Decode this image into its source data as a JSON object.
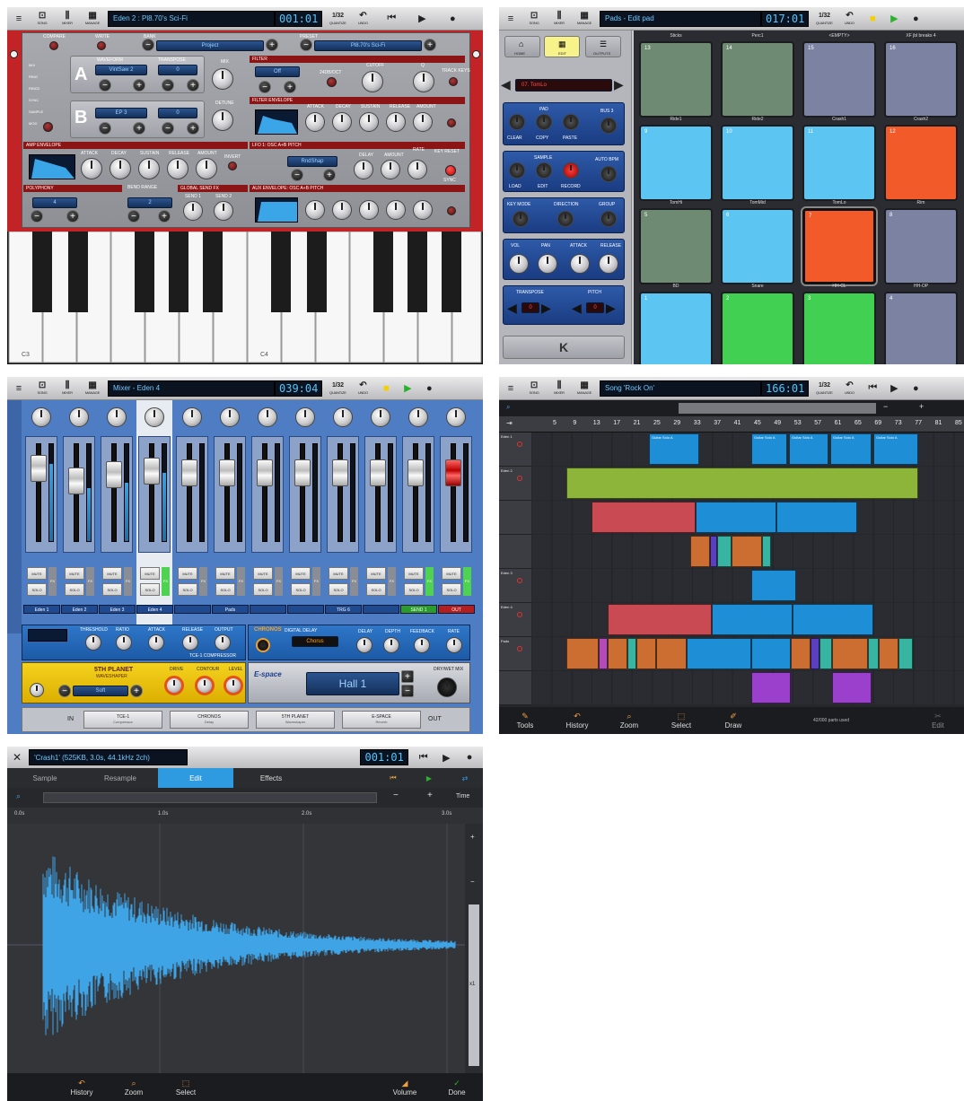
{
  "toolbar": {
    "menu_icon": "≡",
    "song": "SONG",
    "mixer": "MIXER",
    "manage": "MANAGE",
    "quantize_value": "1/32",
    "quantize_label": "QUANTIZE",
    "undo": "UNDO"
  },
  "synth": {
    "title": "Eden 2 : Pl8.70's Sci-Fi",
    "position": "001:01",
    "compare": "COMPARE",
    "write": "WRITE",
    "bank_label": "BANK",
    "bank_value": "Project",
    "preset_label": "PRESET",
    "preset_value": "Pl8.70's Sci-Fi",
    "mix": "MIX",
    "ring": "RING",
    "ring2": "RING2",
    "sync": "SYNC",
    "sample": "SAMPLE",
    "mod": "MOD",
    "osc_a": "A",
    "osc_b": "B",
    "osc_a_label": "OSC",
    "waveform": "WAVEFORM",
    "transpose": "TRANSPOSE",
    "wave_a": "VintSaw 2",
    "trans_a": "0",
    "wave_b": "EP 3",
    "trans_b": "0",
    "mix_knob": "MIX",
    "detune": "DETUNE",
    "filter": "FILTER",
    "filter_type": "Off",
    "filter_slope": "24dB/Oct",
    "cutoff": "CUTOFF",
    "q": "Q",
    "track_keys": "TRACK KEYS",
    "filter_env": "FILTER ENVELOPE",
    "amp_env": "AMP ENVELOPE",
    "attack": "ATTACK",
    "decay": "DECAY",
    "sustain": "SUSTAIN",
    "release": "RELEASE",
    "amount": "AMOUNT",
    "invert": "INVERT",
    "lfo": "LFO 1: Osc A+B Pitch",
    "lfo_shape": "RndShap",
    "delay": "DELAY",
    "rate": "RATE",
    "key_reset": "KEY RESET",
    "sync_lbl": "SYNC",
    "polyphony": "POLYPHONY",
    "poly_val": "4",
    "bend_range": "BEND RANGE",
    "bend_val": "2",
    "global_send": "GLOBAL SEND FX",
    "send1": "SEND 1",
    "send2": "SEND 2",
    "aux_env": "AUX ENVELOPE: Osc A+B Pitch",
    "c3": "C3",
    "c4": "C4"
  },
  "pads": {
    "title": "Pads - Edit pad",
    "position": "017:01",
    "home": "HOME",
    "edit": "EDIT",
    "outputs": "OUTPUTS",
    "instrument": "07. TomLo",
    "pad": "PAD",
    "clear": "CLEAR",
    "copy": "COPY",
    "paste": "PASTE",
    "bus": "BUS 3",
    "sample": "SAMPLE",
    "load": "LOAD",
    "edit_btn": "EDIT",
    "record": "RECORD",
    "auto_bpm": "AUTO BPM",
    "key_mode": "KEY MODE",
    "direction": "DIRECTION",
    "group": "GROUP",
    "vol": "VOL",
    "pan": "PAN",
    "attack": "ATTACK",
    "release": "RELEASE",
    "transpose": "TRANSPOSE",
    "pitch": "PITCH",
    "transpose_val": "0",
    "pitch_val": "0",
    "grid": [
      {
        "name": "Sticks",
        "num": "13",
        "color": "#6e8a72"
      },
      {
        "name": "Perc1",
        "num": "14",
        "color": "#6e8a72"
      },
      {
        "name": "<EMPTY>",
        "num": "15",
        "color": "#7c83a2"
      },
      {
        "name": "XF jbl breaks 4",
        "num": "16",
        "color": "#7c83a2"
      },
      {
        "name": "Ride1",
        "num": "9",
        "color": "#5cc5f2"
      },
      {
        "name": "Ride2",
        "num": "10",
        "color": "#5cc5f2"
      },
      {
        "name": "Crash1",
        "num": "11",
        "color": "#5cc5f2"
      },
      {
        "name": "Crash2",
        "num": "12",
        "color": "#f25a2a"
      },
      {
        "name": "TomHi",
        "num": "5",
        "color": "#6e8a72"
      },
      {
        "name": "TomMid",
        "num": "6",
        "color": "#5cc5f2"
      },
      {
        "name": "TomLo",
        "num": "7",
        "color": "#f25a2a"
      },
      {
        "name": "Rim",
        "num": "8",
        "color": "#7c83a2"
      },
      {
        "name": "BD",
        "num": "1",
        "color": "#5cc5f2"
      },
      {
        "name": "Snare",
        "num": "2",
        "color": "#42d052"
      },
      {
        "name": "HH-CL",
        "num": "3",
        "color": "#42d052"
      },
      {
        "name": "HH-OP",
        "num": "4",
        "color": "#7c83a2"
      }
    ]
  },
  "mixer": {
    "title": "Mixer - Eden 4",
    "position": "039:04",
    "mute": "MUTE",
    "solo": "SOLO",
    "fx": "FX",
    "channels": [
      {
        "name": "Eden 1",
        "level": 0.8,
        "fader": 0.85
      },
      {
        "name": "Eden 2",
        "level": 0.55,
        "fader": 0.72
      },
      {
        "name": "Eden 3",
        "level": 0.6,
        "fader": 0.78
      },
      {
        "name": "Eden 4",
        "level": 0.7,
        "fader": 0.82
      },
      {
        "name": "",
        "level": 0.0,
        "fader": 0.8
      },
      {
        "name": "Pads",
        "level": 0.0,
        "fader": 0.8
      },
      {
        "name": "",
        "level": 0.0,
        "fader": 0.8
      },
      {
        "name": "",
        "level": 0.0,
        "fader": 0.8
      },
      {
        "name": "TRG 6",
        "level": 0.0,
        "fader": 0.8
      },
      {
        "name": "",
        "level": 0.0,
        "fader": 0.8
      },
      {
        "name": "SEND 1",
        "level": 0.0,
        "fader": 0.8
      },
      {
        "name": "OUT",
        "level": 0.0,
        "fader": 0.8
      }
    ],
    "threshold": "THRESHOLD",
    "ratio": "RATIO",
    "attack": "ATTACK",
    "release": "RELEASE",
    "output": "OUTPUT",
    "comp_name": "TCE-1 COMPRESSOR",
    "chronos": "CHRONOS",
    "digital_delay": "DIGITAL DELAY",
    "chorus": "Chorus",
    "delay": "DELAY",
    "depth": "DEPTH",
    "feedback": "FEEDBACK",
    "rate": "RATE",
    "fifth_planet": "5TH PLANET",
    "waveshaper": "WAVESHAPER",
    "shape": "Soft",
    "drive": "DRIVE",
    "contour": "CONTOUR",
    "level": "LEVEL",
    "espace": "E-space",
    "reverb_val": "Hall 1",
    "drywet": "Dry/Wet Mix",
    "chain_in": "IN",
    "chain_out": "OUT",
    "chain": [
      {
        "name": "TCE-1",
        "sub": "Compressor"
      },
      {
        "name": "CHRONOS",
        "sub": "Delay"
      },
      {
        "name": "5TH PLANET",
        "sub": "Waveshaper"
      },
      {
        "name": "E-SPACE",
        "sub": "Reverb"
      }
    ]
  },
  "song": {
    "title": "Song 'Rock On'",
    "position": "166:01",
    "bars": [
      "5",
      "9",
      "13",
      "17",
      "21",
      "25",
      "29",
      "33",
      "37",
      "41",
      "45",
      "49",
      "53",
      "57",
      "61",
      "65",
      "69",
      "73",
      "77",
      "81",
      "85"
    ],
    "tracks": [
      "Eden 1",
      "Eden 2",
      "",
      "",
      "Eden 3",
      "Eden 4",
      "Pads",
      ""
    ],
    "clip_guitar": "Guitar Solo A",
    "tools": "Tools",
    "history": "History",
    "zoom": "Zoom",
    "select": "Select",
    "draw": "Draw",
    "parts_used": "42/000 parts used",
    "edit": "Edit"
  },
  "sample": {
    "title": "'Crash1' (525KB, 3.0s, 44.1kHz 2ch)",
    "position": "001:01",
    "tab_sample": "Sample",
    "tab_resample": "Resample",
    "tab_edit": "Edit",
    "tab_effects": "Effects",
    "time": "Time",
    "t0": "0.0s",
    "t1": "1.0s",
    "t2": "2.0s",
    "t3": "3.0s",
    "zoom_x": "x1",
    "history": "History",
    "zoom": "Zoom",
    "select": "Select",
    "volume": "Volume",
    "done": "Done"
  }
}
